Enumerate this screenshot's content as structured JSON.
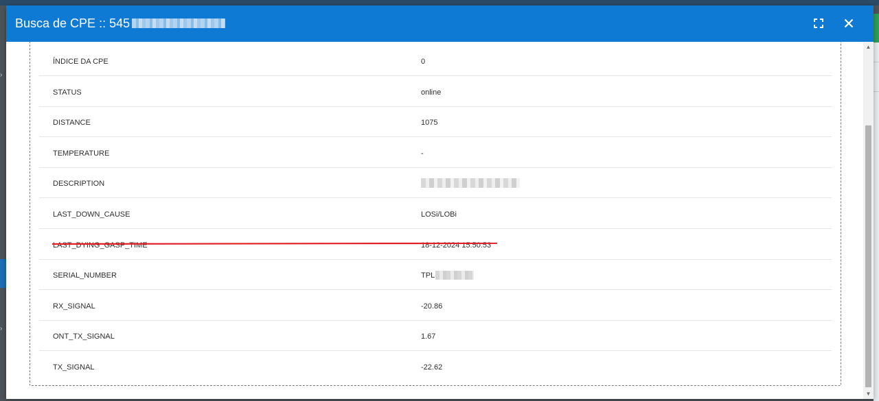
{
  "modal": {
    "title": "Busca de CPE :: 545",
    "expand_icon": "fullscreen-icon",
    "close_icon": "close-icon"
  },
  "colors": {
    "header": "#0f7ad3",
    "underline": "#e31b23"
  },
  "rows": [
    {
      "key": "ÍNDICE DA CPE",
      "value": "0"
    },
    {
      "key": "STATUS",
      "value": "online"
    },
    {
      "key": "DISTANCE",
      "value": "1075"
    },
    {
      "key": "TEMPERATURE",
      "value": "-"
    },
    {
      "key": "DESCRIPTION",
      "value": ""
    },
    {
      "key": "LAST_DOWN_CAUSE",
      "value": "LOSi/LOBi"
    },
    {
      "key": "LAST_DYING_GASP_TIME",
      "value": "18-12-2024 15:50:53"
    },
    {
      "key": "SERIAL_NUMBER",
      "value": "TPL"
    },
    {
      "key": "RX_SIGNAL",
      "value": "-20.86"
    },
    {
      "key": "ONT_TX_SIGNAL",
      "value": "1.67"
    },
    {
      "key": "TX_SIGNAL",
      "value": "-22.62"
    }
  ]
}
